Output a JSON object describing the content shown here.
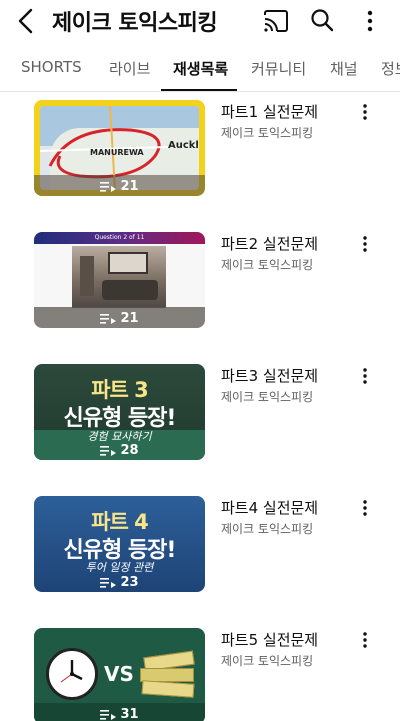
{
  "app": {
    "title": "제이크 토익스피킹"
  },
  "tabs": [
    {
      "label": "SHORTS",
      "active": false
    },
    {
      "label": "라이브",
      "active": false
    },
    {
      "label": "재생목록",
      "active": true
    },
    {
      "label": "커뮤니티",
      "active": false
    },
    {
      "label": "채널",
      "active": false
    },
    {
      "label": "정보",
      "active": false
    }
  ],
  "playlists": [
    {
      "title": "파트1 실전문제",
      "channel": "제이크 토익스피킹",
      "video_count": "21",
      "thumb": {
        "map_labels": [
          "MANUREWA",
          "Auckla"
        ]
      }
    },
    {
      "title": "파트2 실전문제",
      "channel": "제이크 토익스피킹",
      "video_count": "21",
      "thumb": {
        "header": "Question 2 of 11"
      }
    },
    {
      "title": "파트3 실전문제",
      "channel": "제이크 토익스피킹",
      "video_count": "28",
      "thumb": {
        "line1": "파트 3",
        "line2": "신유형 등장!",
        "handwriting": "경험 묘사하기"
      }
    },
    {
      "title": "파트4 실전문제",
      "channel": "제이크 토익스피킹",
      "video_count": "23",
      "thumb": {
        "line1": "파트 4",
        "line2": "신유형 등장!",
        "handwriting": "투어 일정 관련"
      }
    },
    {
      "title": "파트5 실전문제",
      "channel": "제이크 토익스피킹",
      "video_count": "31",
      "thumb": {
        "vs": "VS"
      }
    }
  ],
  "icons": {
    "back": "back-arrow-icon",
    "cast": "cast-icon",
    "search": "search-icon",
    "more": "more-vert-icon",
    "playlist": "playlist-play-icon"
  },
  "colors": {
    "text_primary": "#0f0f0f",
    "text_secondary": "#606060",
    "divider": "#e5e5e5"
  }
}
